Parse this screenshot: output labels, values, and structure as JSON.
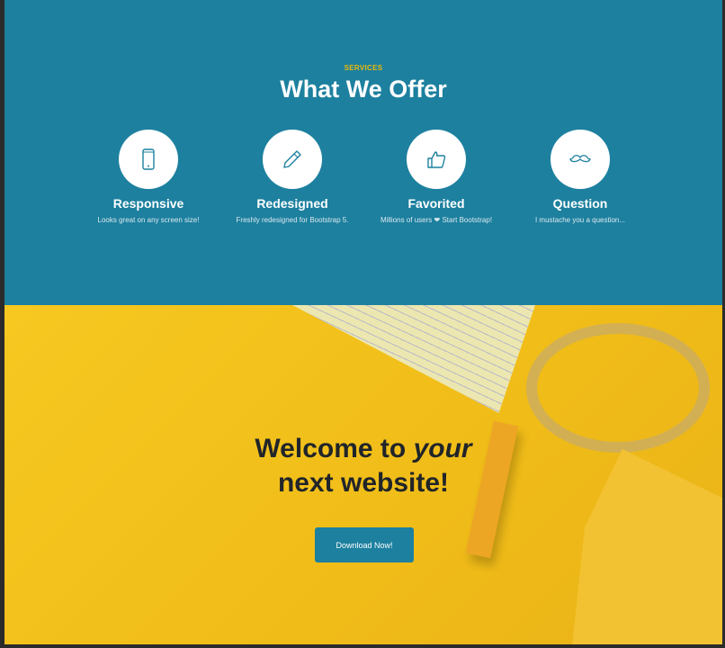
{
  "services": {
    "eyebrow": "SERVICES",
    "title": "What We Offer",
    "items": [
      {
        "icon": "phone-icon",
        "title": "Responsive",
        "text": "Looks great on any screen size!"
      },
      {
        "icon": "pencil-icon",
        "title": "Redesigned",
        "text": "Freshly redesigned for Bootstrap 5."
      },
      {
        "icon": "thumbs-up-icon",
        "title": "Favorited",
        "text_before": "Millions of users",
        "text_after": "Start Bootstrap!"
      },
      {
        "icon": "mustache-icon",
        "title": "Question",
        "text": "I mustache you a question..."
      }
    ]
  },
  "hero": {
    "title_part1": "Welcome to ",
    "title_em": "your",
    "title_part2": "next website!",
    "button": "Download Now!"
  },
  "colors": {
    "primary": "#1d809f",
    "accent": "#ecb807",
    "hero": "#f4c11e"
  }
}
